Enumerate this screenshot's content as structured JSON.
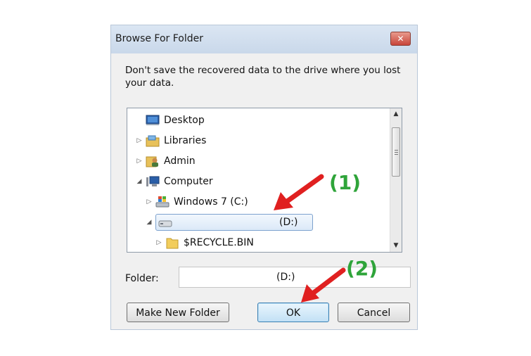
{
  "dialog": {
    "title": "Browse For Folder",
    "close_label": "✕",
    "instruction": "Don't save the recovered data to the drive where you lost your data."
  },
  "tree": {
    "items": [
      {
        "label": "Desktop",
        "icon": "desktop-icon",
        "expander": ""
      },
      {
        "label": "Libraries",
        "icon": "libraries-icon",
        "expander": "▷"
      },
      {
        "label": "Admin",
        "icon": "user-folder-icon",
        "expander": "▷"
      },
      {
        "label": "Computer",
        "icon": "computer-icon",
        "expander": "◢"
      },
      {
        "label": "Windows 7 (C:)",
        "icon": "windows-drive-icon",
        "expander": "▷"
      },
      {
        "label": "(D:)",
        "icon": "drive-icon",
        "expander": "◢",
        "selected": true
      },
      {
        "label": "$RECYCLE.BIN",
        "icon": "folder-icon",
        "expander": "▷"
      }
    ]
  },
  "folder": {
    "label": "Folder:",
    "value": "(D:)"
  },
  "buttons": {
    "make_new_folder": "Make New Folder",
    "ok": "OK",
    "cancel": "Cancel"
  },
  "annotations": {
    "step1": "(1)",
    "step2": "(2)",
    "color": "#2fa43a",
    "arrow_color": "#e02020"
  }
}
